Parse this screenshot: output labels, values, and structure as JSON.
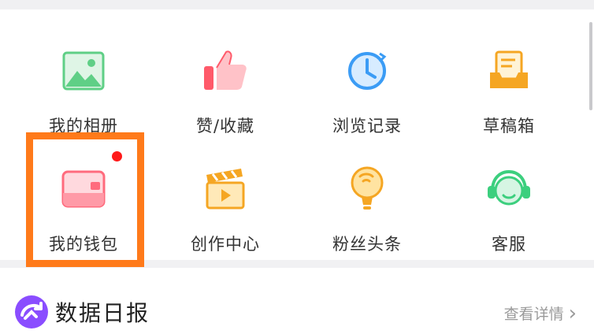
{
  "grid": {
    "items": [
      {
        "label": "我的相册",
        "icon": "photo-album-icon"
      },
      {
        "label": "赞/收藏",
        "icon": "thumbs-up-icon"
      },
      {
        "label": "浏览记录",
        "icon": "clock-icon"
      },
      {
        "label": "草稿箱",
        "icon": "draft-box-icon"
      },
      {
        "label": "我的钱包",
        "icon": "wallet-icon",
        "badge": true
      },
      {
        "label": "创作中心",
        "icon": "clapperboard-icon"
      },
      {
        "label": "粉丝头条",
        "icon": "lightbulb-icon"
      },
      {
        "label": "客服",
        "icon": "headset-icon"
      }
    ]
  },
  "report": {
    "title": "数据日报",
    "link": "查看详情",
    "link_chevron": "›"
  },
  "colors": {
    "highlight": "#ff7a1a",
    "badge": "#ff1a1a",
    "report_icon": "#8a4dff"
  }
}
